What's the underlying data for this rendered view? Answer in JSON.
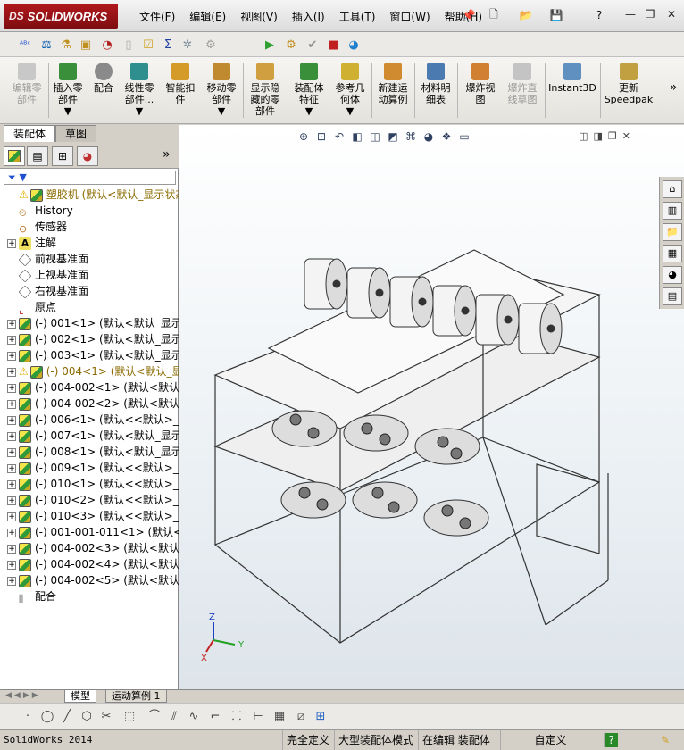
{
  "app": {
    "logo_text": "SOLIDWORKS",
    "logo_prefix": "DS"
  },
  "menu": [
    "文件(F)",
    "编辑(E)",
    "视图(V)",
    "插入(I)",
    "工具(T)",
    "窗口(W)",
    "帮助(H)"
  ],
  "command_manager": [
    {
      "label": "编辑零\n部件",
      "disabled": true,
      "color": "#b0b0b0"
    },
    {
      "label": "插入零\n部件\n▼",
      "disabled": false,
      "color": "#3a8f3a"
    },
    {
      "label": "配合",
      "disabled": false,
      "color": "#7a7a7a"
    },
    {
      "label": "线性零\n部件...\n▼",
      "disabled": false,
      "color": "#2f8f8f"
    },
    {
      "label": "智能扣\n件",
      "disabled": false,
      "color": "#d49a2a"
    },
    {
      "label": "移动零\n部件\n▼",
      "disabled": false,
      "color": "#c08a30"
    },
    {
      "label": "显示隐\n藏的零\n部件",
      "disabled": false,
      "color": "#d0a040"
    },
    {
      "label": "装配体\n特征\n▼",
      "disabled": false,
      "color": "#3a8f3a"
    },
    {
      "label": "参考几\n何体\n▼",
      "disabled": false,
      "color": "#d0b030"
    },
    {
      "label": "新建运\n动算例",
      "disabled": false,
      "color": "#d08a30"
    },
    {
      "label": "材料明\n细表",
      "disabled": false,
      "color": "#4a7ab0"
    },
    {
      "label": "爆炸视\n图",
      "disabled": false,
      "color": "#d08030"
    },
    {
      "label": "爆炸直\n线草图",
      "disabled": true,
      "color": "#b0b0b0"
    },
    {
      "label": "Instant3D",
      "disabled": false,
      "color": "#6090c0"
    },
    {
      "label": "更新\nSpeedpak",
      "disabled": false,
      "color": "#c0a040"
    }
  ],
  "cmd_overflow": "»",
  "tabs": {
    "assembly": "装配体",
    "sketch": "草图"
  },
  "panel": {
    "expand": "»",
    "filter": "▼"
  },
  "tree": [
    {
      "label": "塑胶机  (默认<默认_显示状态",
      "icon": "cube",
      "expander": "",
      "warn": true
    },
    {
      "label": "History",
      "icon": "history",
      "expander": ""
    },
    {
      "label": "传感器",
      "icon": "sensor",
      "expander": ""
    },
    {
      "label": "注解",
      "icon": "annot",
      "expander": "+"
    },
    {
      "label": "前视基准面",
      "icon": "plane",
      "expander": ""
    },
    {
      "label": "上视基准面",
      "icon": "plane",
      "expander": ""
    },
    {
      "label": "右视基准面",
      "icon": "plane",
      "expander": ""
    },
    {
      "label": "原点",
      "icon": "origin",
      "expander": ""
    },
    {
      "label": "(-) 001<1> (默认<默认_显示",
      "icon": "cube",
      "expander": "+"
    },
    {
      "label": "(-) 002<1> (默认<默认_显示",
      "icon": "cube",
      "expander": "+"
    },
    {
      "label": "(-) 003<1> (默认<默认_显示",
      "icon": "cube",
      "expander": "+"
    },
    {
      "label": "(-) 004<1> (默认<默认_显",
      "icon": "cube",
      "expander": "+",
      "warn": true
    },
    {
      "label": "(-) 004-002<1> (默认<默认",
      "icon": "cube",
      "expander": "+"
    },
    {
      "label": "(-) 004-002<2> (默认<默认",
      "icon": "cube",
      "expander": "+"
    },
    {
      "label": "(-) 006<1> (默认<<默认>_显",
      "icon": "cube",
      "expander": "+"
    },
    {
      "label": "(-) 007<1> (默认<默认_显示",
      "icon": "cube",
      "expander": "+"
    },
    {
      "label": "(-) 008<1> (默认<默认_显示",
      "icon": "cube",
      "expander": "+"
    },
    {
      "label": "(-) 009<1> (默认<<默认>_显",
      "icon": "cube",
      "expander": "+"
    },
    {
      "label": "(-) 010<1> (默认<<默认>_显",
      "icon": "cube",
      "expander": "+"
    },
    {
      "label": "(-) 010<2> (默认<<默认>_显",
      "icon": "cube",
      "expander": "+"
    },
    {
      "label": "(-) 010<3> (默认<<默认>_显",
      "icon": "cube",
      "expander": "+"
    },
    {
      "label": "(-) 001-001-011<1> (默认<<",
      "icon": "cube",
      "expander": "+"
    },
    {
      "label": "(-) 004-002<3> (默认<默认",
      "icon": "cube",
      "expander": "+"
    },
    {
      "label": "(-) 004-002<4> (默认<默认",
      "icon": "cube",
      "expander": "+"
    },
    {
      "label": "(-) 004-002<5> (默认<默认",
      "icon": "cube",
      "expander": "+"
    },
    {
      "label": "配合",
      "icon": "mates",
      "expander": ""
    }
  ],
  "bottom_tabs": [
    "模型",
    "运动算例 1"
  ],
  "triad": {
    "x": "X",
    "y": "Y",
    "z": "Z"
  },
  "status": {
    "app": "SolidWorks 2014",
    "fully": "完全定义",
    "large": "大型装配体模式",
    "editing": "在编辑 装配体",
    "custom": "自定义",
    "help": "?"
  },
  "colors": {
    "brand": "#a8141a",
    "selected": "#2a5bd7",
    "warning": "#e0b000"
  }
}
